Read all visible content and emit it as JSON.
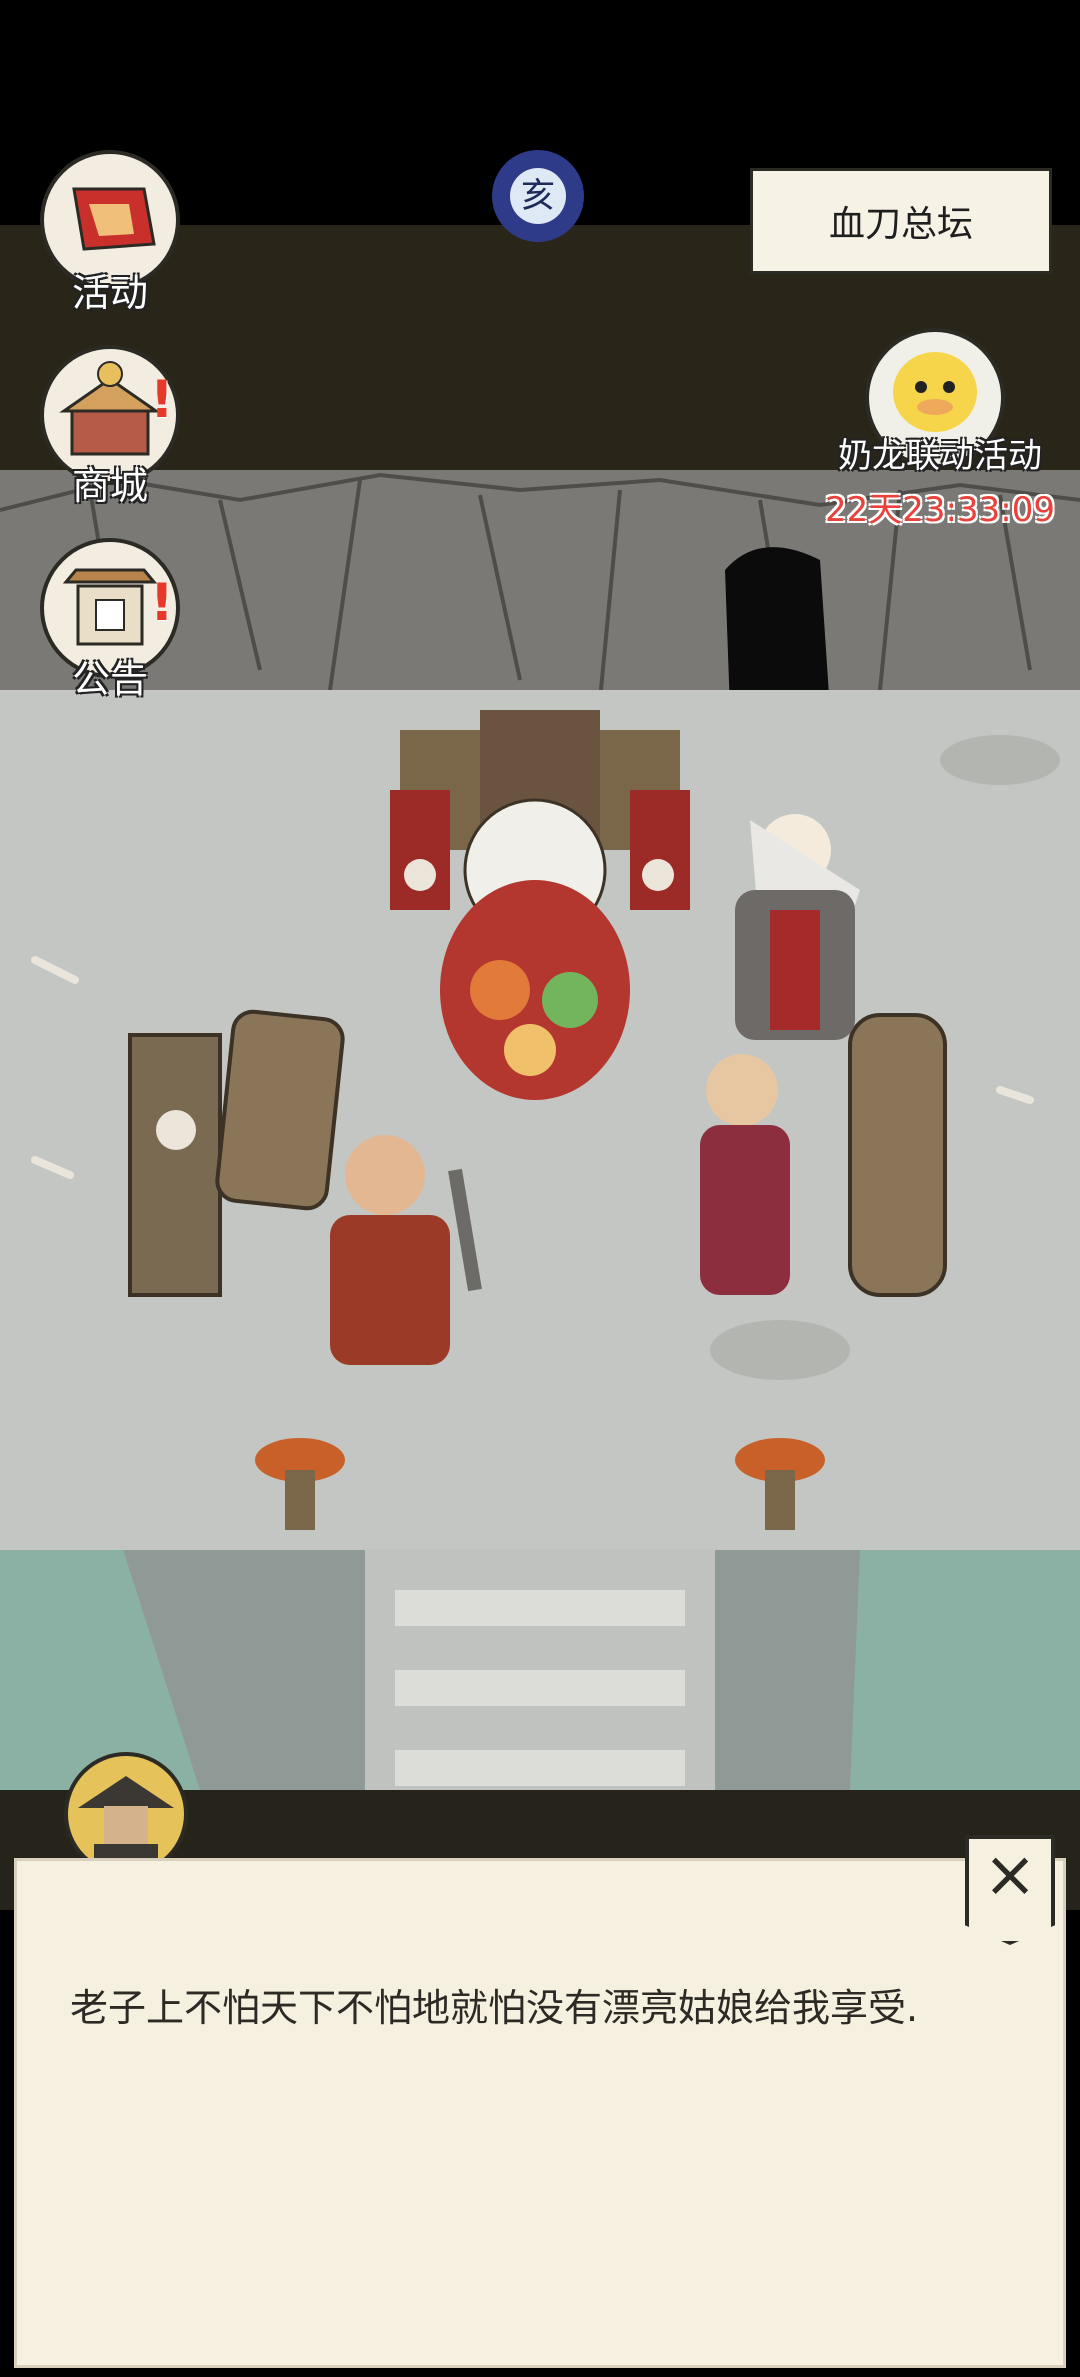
{
  "menu": {
    "activity": "活动",
    "shop": "商城",
    "notice": "公告"
  },
  "location_name": "血刀总坛",
  "event": {
    "title": "奶龙联动活动",
    "timer": "22天23:33:09"
  },
  "time_icon_char": "亥",
  "dialog": {
    "text": "老子上不怕天下不怕地就怕没有漂亮姑娘给我享受."
  },
  "icons": {
    "activity": "flag-icon",
    "shop": "shop-icon",
    "notice": "notice-board-icon",
    "close": "close-icon",
    "speaker": "straw-hat-avatar",
    "time": "moon-time-icon"
  },
  "colors": {
    "dialog_bg": "#f6f0e1",
    "timer_red": "#e8423a",
    "badge_red": "#e53a2a"
  }
}
